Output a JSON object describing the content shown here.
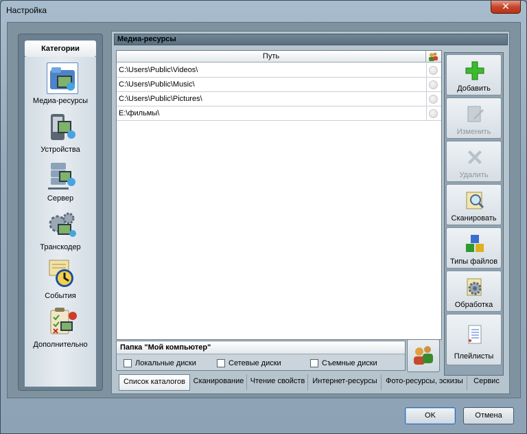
{
  "window": {
    "title": "Настройка",
    "close_glyph": "✕"
  },
  "categories": {
    "header": "Категории",
    "items": [
      {
        "label": "Медиа-ресурсы",
        "icon": "media-resources-icon",
        "selected": true
      },
      {
        "label": "Устройства",
        "icon": "devices-icon",
        "selected": false
      },
      {
        "label": "Сервер",
        "icon": "server-icon",
        "selected": false
      },
      {
        "label": "Транскодер",
        "icon": "transcoder-icon",
        "selected": false
      },
      {
        "label": "События",
        "icon": "events-icon",
        "selected": false
      },
      {
        "label": "Дополнительно",
        "icon": "additional-icon",
        "selected": false
      }
    ]
  },
  "main": {
    "header": "Медиа-ресурсы",
    "table": {
      "column_path": "Путь",
      "column_icon": "users-icon",
      "rows": [
        "C:\\Users\\Public\\Videos\\",
        "C:\\Users\\Public\\Music\\",
        "C:\\Users\\Public\\Pictures\\",
        "E:\\фильмы\\"
      ]
    }
  },
  "side_buttons": {
    "add": {
      "label": "Добавить",
      "enabled": true
    },
    "edit": {
      "label": "Изменить",
      "enabled": false
    },
    "delete": {
      "label": "Удалить",
      "enabled": false
    },
    "scan": {
      "label": "Сканировать",
      "enabled": true
    },
    "file_types": {
      "label": "Типы файлов",
      "enabled": true
    },
    "processing": {
      "label": "Обработка",
      "enabled": true
    },
    "playlists": {
      "label": "Плейлисты",
      "enabled": true
    }
  },
  "my_computer": {
    "header": "Папка \"Мой компьютер\"",
    "local": "Локальные диски",
    "network": "Сетевые диски",
    "removable": "Съемные диски"
  },
  "tabs": [
    "Список каталогов",
    "Сканирование",
    "Чтение свойств",
    "Интернет-ресурсы",
    "Фото-ресурсы, эскизы",
    "Сервис"
  ],
  "footer": {
    "ok": "OK",
    "cancel": "Отмена"
  },
  "colors": {
    "accent_green": "#3cba2c",
    "selection_border": "#5b86b9",
    "close_red": "#c6452c"
  }
}
